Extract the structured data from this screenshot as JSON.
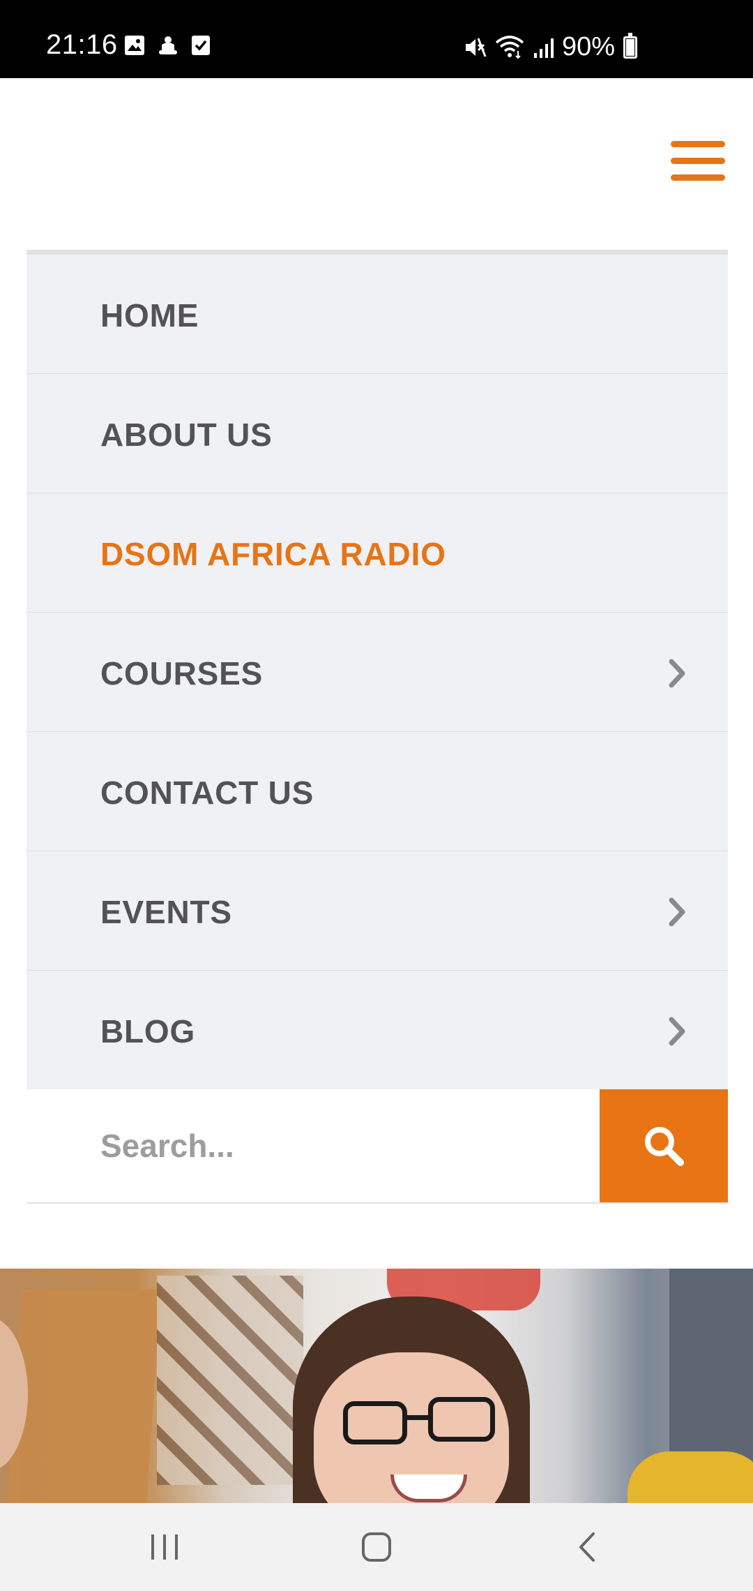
{
  "status_bar": {
    "time": "21:16",
    "battery_text": "90%",
    "icons_left": [
      "image-icon",
      "android-icon",
      "checkbox-icon"
    ],
    "icons_right": [
      "mute-icon",
      "wifi-icon",
      "signal-icon",
      "battery-icon"
    ],
    "battery_level": 0.9
  },
  "header": {
    "menu_icon": "hamburger-icon"
  },
  "nav": {
    "items": [
      {
        "label": "HOME",
        "active": false,
        "has_submenu": false
      },
      {
        "label": "ABOUT US",
        "active": false,
        "has_submenu": false
      },
      {
        "label": "DSOM AFRICA RADIO",
        "active": true,
        "has_submenu": false
      },
      {
        "label": "COURSES",
        "active": false,
        "has_submenu": true
      },
      {
        "label": "CONTACT US",
        "active": false,
        "has_submenu": false
      },
      {
        "label": "EVENTS",
        "active": false,
        "has_submenu": true
      },
      {
        "label": "BLOG",
        "active": false,
        "has_submenu": true
      }
    ]
  },
  "search": {
    "placeholder": "Search...",
    "value": "",
    "button_icon": "search-icon"
  },
  "colors": {
    "accent": "#e87414",
    "nav_text": "#535355",
    "nav_background": "#f0f1f4"
  },
  "system_nav": {
    "buttons": [
      "recents-icon",
      "home-icon",
      "back-icon"
    ]
  }
}
